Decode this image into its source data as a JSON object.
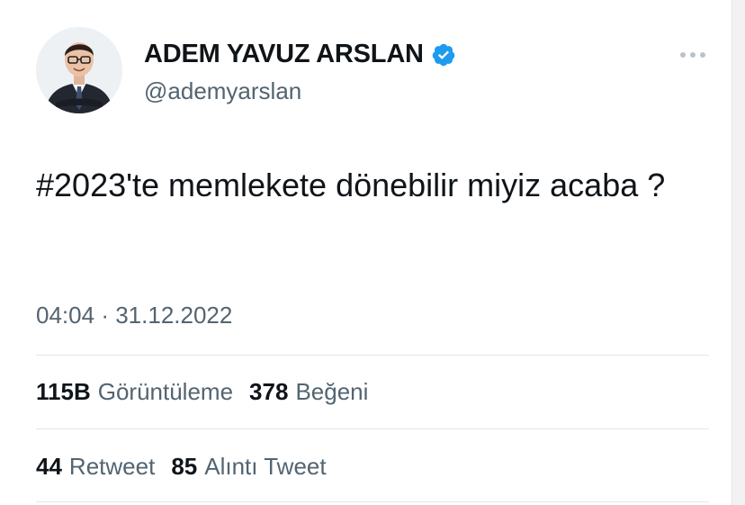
{
  "author": {
    "display_name": "ADEM YAVUZ ARSLAN",
    "handle": "@ademyarslan",
    "verified": true,
    "verified_color": "#1d9bf0"
  },
  "tweet": {
    "text": "#2023'te memlekete dönebilir miyiz acaba ?",
    "time": "04:04",
    "separator": "·",
    "date": "31.12.2022"
  },
  "stats": {
    "views_count": "115B",
    "views_label": "Görüntüleme",
    "likes_count": "378",
    "likes_label": "Beğeni",
    "retweets_count": "44",
    "retweets_label": "Retweet",
    "quotes_count": "85",
    "quotes_label": "Alıntı Tweet"
  },
  "icons": {
    "more": "more-horizontal-icon",
    "verified": "verified-badge-icon"
  },
  "colors": {
    "text_primary": "#0f1419",
    "text_secondary": "#536471",
    "divider": "#e1e6ea"
  }
}
